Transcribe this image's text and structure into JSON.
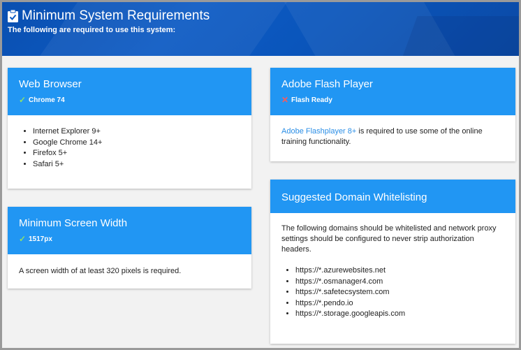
{
  "header": {
    "title": "Minimum System Requirements",
    "subtitle": "The following are required to use this system:",
    "icon": "clipboard-check-icon",
    "background_color": "#0a4fb0"
  },
  "accent_color": "#2196f3",
  "cards": {
    "web_browser": {
      "title": "Web Browser",
      "status_icon": "check-icon",
      "status_text": "Chrome 74",
      "items": [
        "Internet Explorer 9+",
        "Google Chrome 14+",
        "Firefox 5+",
        "Safari 5+"
      ]
    },
    "screen_width": {
      "title": "Minimum Screen Width",
      "status_icon": "check-icon",
      "status_text": "1517px",
      "body": "A screen width of at least 320 pixels is required."
    },
    "flash": {
      "title": "Adobe Flash Player",
      "status_icon": "cross-icon",
      "status_text": "Flash Ready",
      "link_text": "Adobe Flashplayer 8+",
      "body_rest": " is required to use some of the online training functionality."
    },
    "whitelist": {
      "title": "Suggested Domain Whitelisting",
      "body": "The following domains should be whitelisted and network proxy settings should be configured to never strip authorization headers.",
      "domains": [
        "https://*.azurewebsites.net",
        "https://*.osmanager4.com",
        "https://*.safetecsystem.com",
        "https://*.pendo.io",
        "https://*.storage.googleapis.com"
      ]
    }
  },
  "status_colors": {
    "ok": "#8ee06a",
    "fail": "#ff5a5a"
  }
}
